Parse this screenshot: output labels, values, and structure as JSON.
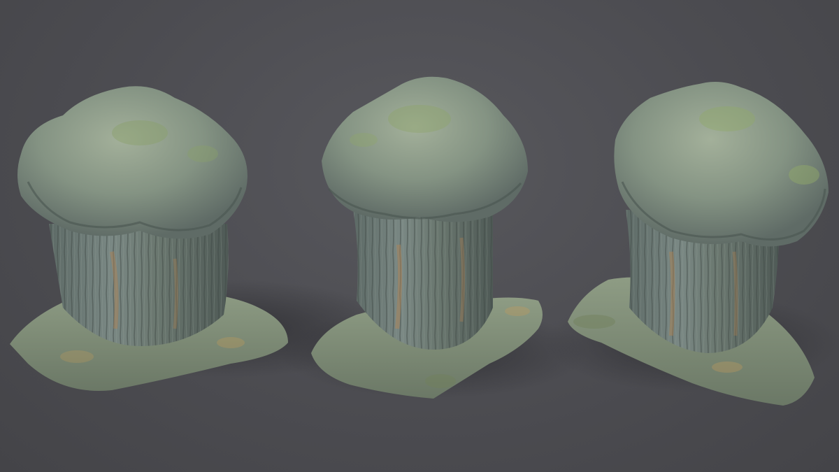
{
  "scene": {
    "background_color": "#4c4c51",
    "objects": [
      {
        "name": "rock-formation-left",
        "colors": {
          "base": "#7f9078",
          "stem": "#6d7a72",
          "moss": "#8aa06a",
          "rust": "#b08050"
        }
      },
      {
        "name": "rock-formation-center",
        "colors": {
          "base": "#8a9a80",
          "stem": "#727e76",
          "moss": "#8ea46c",
          "rust": "#b58552"
        }
      },
      {
        "name": "rock-formation-right",
        "colors": {
          "base": "#849480",
          "stem": "#6f7b73",
          "moss": "#90a86a",
          "rust": "#b28250"
        }
      }
    ]
  }
}
